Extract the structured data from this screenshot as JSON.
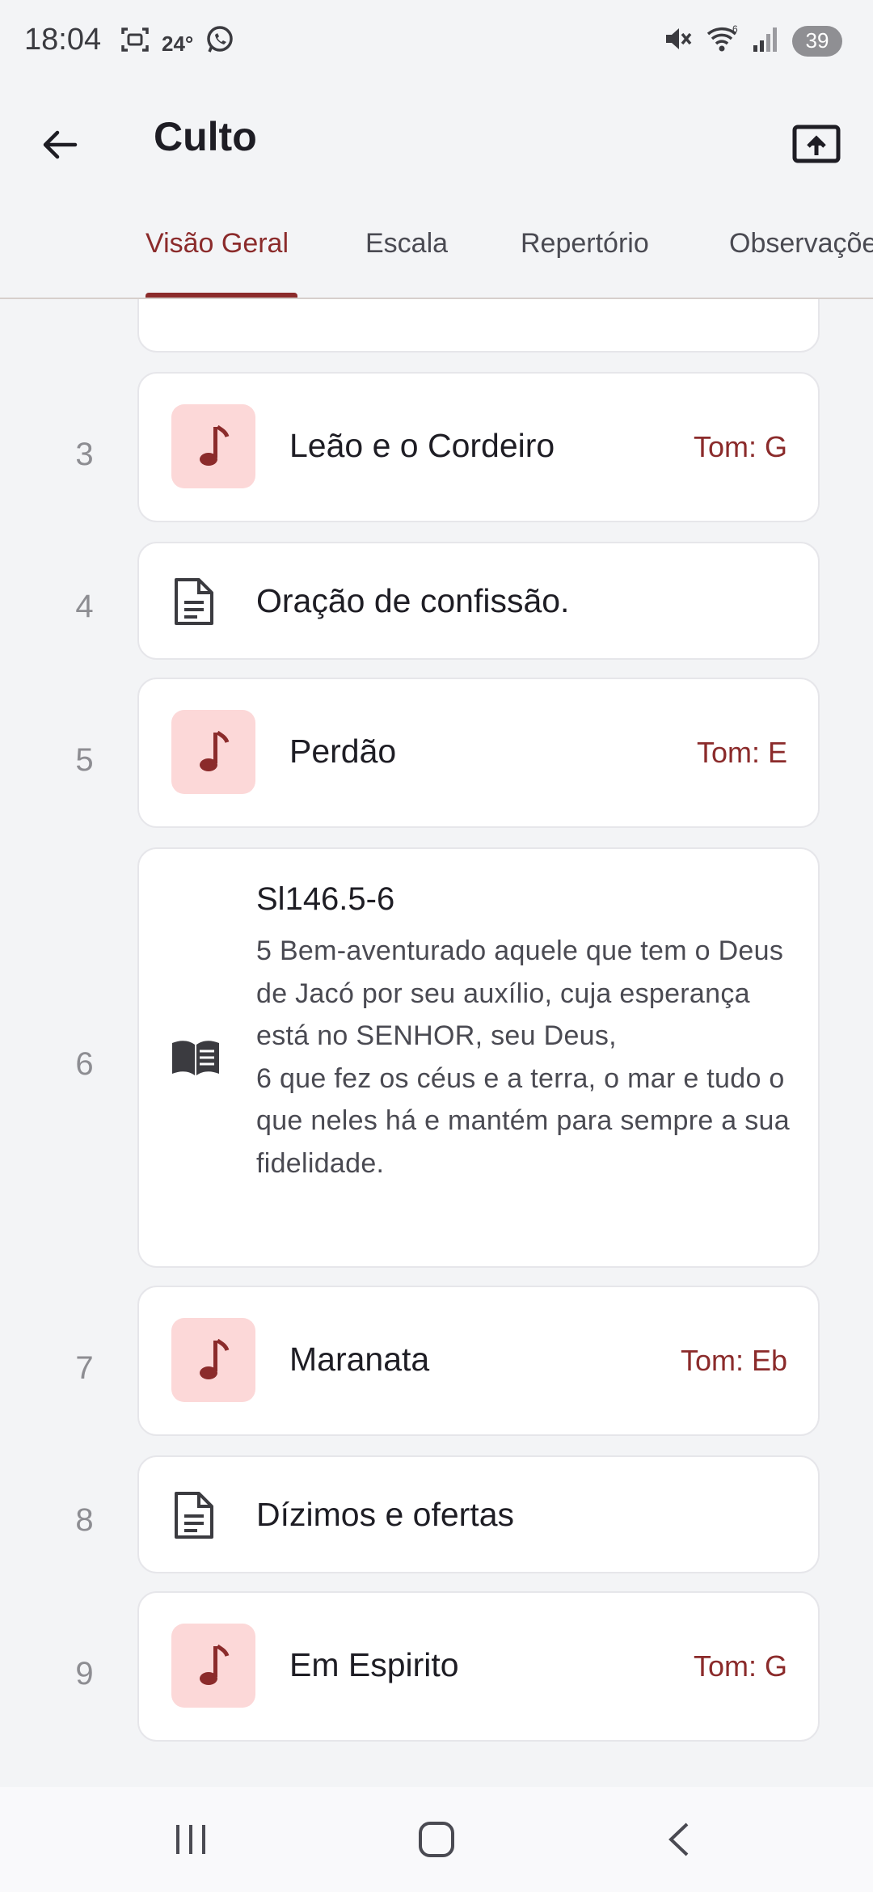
{
  "status_bar": {
    "time": "18:04",
    "temperature": "24°",
    "battery": "39",
    "wifi_label": "6"
  },
  "header": {
    "title": "Culto"
  },
  "tabs": [
    {
      "label": "Visão Geral",
      "active": true
    },
    {
      "label": "Escala",
      "active": false
    },
    {
      "label": "Repertório",
      "active": false
    },
    {
      "label": "Observações",
      "active": false
    }
  ],
  "items": [
    {
      "number": "3",
      "type": "song",
      "title": "Leão e o Cordeiro",
      "tom": "Tom: G"
    },
    {
      "number": "4",
      "type": "text",
      "title": "Oração de confissão."
    },
    {
      "number": "5",
      "type": "song",
      "title": "Perdão",
      "tom": "Tom: E"
    },
    {
      "number": "6",
      "type": "reading",
      "title": "Sl146.5-6",
      "body": "5 Bem-aventurado aquele que tem o Deus de Jacó por seu auxílio, cuja esperança está no SENHOR, seu Deus,\n6 que fez os céus e a terra, o mar e tudo o que neles há e mantém para sempre a sua fidelidade."
    },
    {
      "number": "7",
      "type": "song",
      "title": "Maranata",
      "tom": "Tom: Eb"
    },
    {
      "number": "8",
      "type": "text",
      "title": "Dízimos e ofertas"
    },
    {
      "number": "9",
      "type": "song",
      "title": "Em Espirito",
      "tom": "Tom: G"
    }
  ],
  "colors": {
    "accent": "#8b2b2b",
    "tile_bg": "#fcd8d8",
    "background": "#f3f4f6"
  }
}
